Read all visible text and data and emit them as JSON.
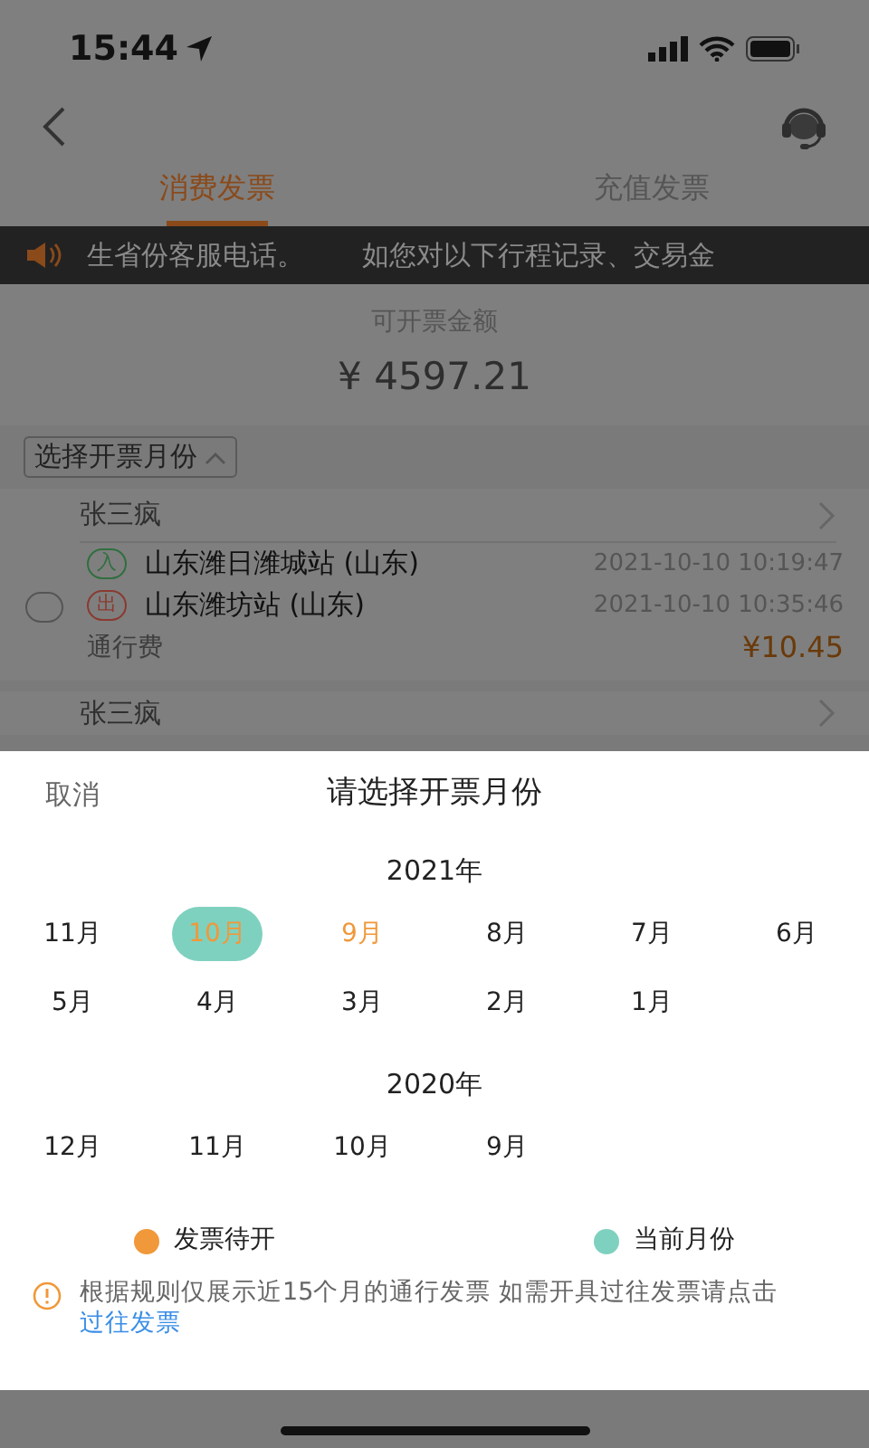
{
  "status_bar": {
    "time": "15:44"
  },
  "tabs": [
    {
      "label": "消费发票",
      "selected": true
    },
    {
      "label": "充值发票",
      "selected": false
    }
  ],
  "notice": {
    "segments": [
      "生省份客服电话。",
      "如您对以下行程记录、交易金"
    ]
  },
  "summary": {
    "label": "可开票金额",
    "amount": "¥ 4597.21"
  },
  "month_filter": {
    "label": "选择开票月份"
  },
  "records": [
    {
      "name": "张三疯",
      "checked": false,
      "entry": {
        "tag": "入",
        "station": "山东潍日潍城站 (山东)",
        "time": "2021-10-10 10:19:47"
      },
      "exit": {
        "tag": "出",
        "station": "山东潍坊站 (山东)",
        "time": "2021-10-10 10:35:46"
      },
      "fee_label": "通行费",
      "fee": "¥10.45"
    },
    {
      "name": "张三疯"
    }
  ],
  "sheet": {
    "cancel": "取消",
    "title": "请选择开票月份",
    "years": [
      {
        "label": "2021年",
        "months": [
          {
            "label": "11月",
            "pending": false,
            "current": false
          },
          {
            "label": "10月",
            "pending": true,
            "current": true
          },
          {
            "label": "9月",
            "pending": true,
            "current": false
          },
          {
            "label": "8月",
            "pending": false,
            "current": false
          },
          {
            "label": "7月",
            "pending": false,
            "current": false
          },
          {
            "label": "6月",
            "pending": false,
            "current": false
          },
          {
            "label": "5月",
            "pending": false,
            "current": false
          },
          {
            "label": "4月",
            "pending": false,
            "current": false
          },
          {
            "label": "3月",
            "pending": false,
            "current": false
          },
          {
            "label": "2月",
            "pending": false,
            "current": false
          },
          {
            "label": "1月",
            "pending": false,
            "current": false
          }
        ]
      },
      {
        "label": "2020年",
        "months": [
          {
            "label": "12月",
            "pending": false,
            "current": false
          },
          {
            "label": "11月",
            "pending": false,
            "current": false
          },
          {
            "label": "10月",
            "pending": false,
            "current": false
          },
          {
            "label": "9月",
            "pending": false,
            "current": false
          }
        ]
      }
    ],
    "legend": [
      {
        "label": "发票待开",
        "color": "#f0983a"
      },
      {
        "label": "当前月份",
        "color": "#7fd1bf"
      }
    ],
    "note": {
      "text": "根据规则仅展示近15个月的通行发票 如需开具过往发票请点击",
      "link": "过往发票"
    }
  }
}
